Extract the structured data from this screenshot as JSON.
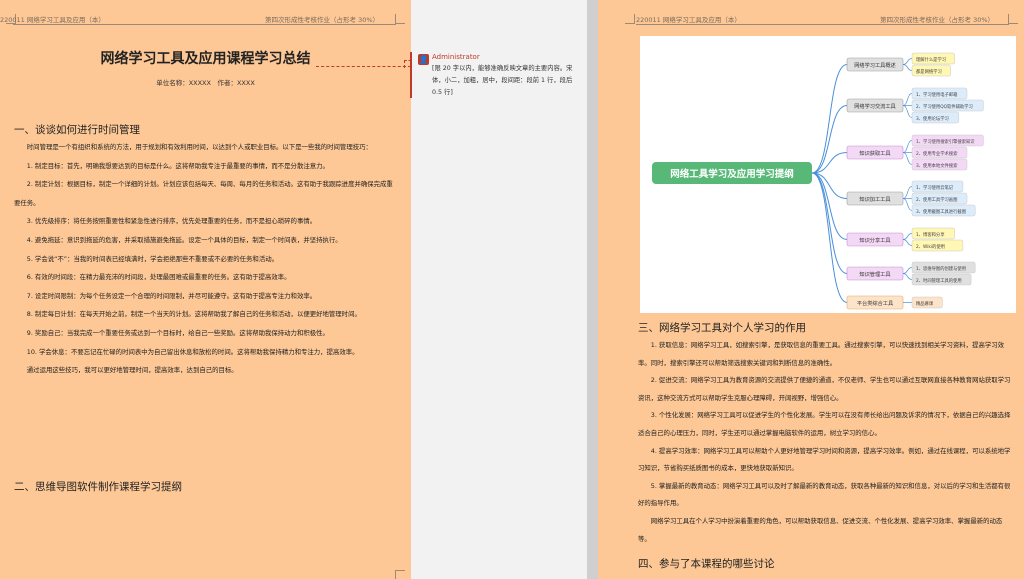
{
  "left_page": {
    "header_left": "220011 网络学习工具及应用（本）",
    "header_right": "第四次形成性考核作业（占形考 30%）",
    "title": "网络学习工具及应用课程学习总结",
    "subtitle": "单位名称：XXXXX　作者：XXXX",
    "section1": "一、谈谈如何进行时间管理",
    "intro": "时间管理是一个有组织和系统的方法，用于规划和有效利用时间，以达到个人或职业目标。以下是一些我的时间管理技巧：",
    "items": [
      "1. 制定目标：首先，明确我想要达到的目标是什么。这将帮助我专注于最重要的事情，而不是分散注意力。",
      "2. 制定计划：根据目标，制定一个详细的计划。计划应该包括每天、每周、每月的任务和活动。这有助于我跟踪进度并确保完成重要任务。",
      "3. 优先级排序：将任务按照重要性和紧急性进行排序，优先处理重要的任务，而不是担心琐碎的事情。",
      "4. 避免拖延：意识到拖延的危害，并采取措施避免拖延。设定一个具体的目标，制定一个时间表，并坚持执行。",
      "5. 学会说“不”：当我的时间表已经填满时，学会拒绝那些不重要或不必要的任务和活动。",
      "6. 有效的时间段：在精力最充沛的时间段，处理最困难或最重要的任务。这有助于提高效率。",
      "7. 设定时间限制：为每个任务设定一个合理的时间限制，并尽可能遵守。这有助于提高专注力和效率。",
      "8. 制定每日计划：在每天开始之前，制定一个当天的计划。这将帮助我了解自己的任务和活动，以便更好地管理时间。",
      "9. 奖励自己：当我完成一个重要任务或达到一个目标时，给自己一些奖励。这将帮助我保持动力和积极性。",
      "10. 学会休息：不要忘记在忙碌的时间表中为自己留出休息和放松的时间。这将帮助我保持精力和专注力，提高效率。"
    ],
    "conclusion": "通过运用这些技巧，我可以更好地管理时间，提高效率，达到自己的目标。",
    "section2": "二、思维导图软件制作课程学习提纲"
  },
  "comment": {
    "author": "Administrator",
    "text": "[限 20 字以内，能够准确反映文章的主要内容。宋体，小二，加粗，居中，段间距：段前 1 行，段后 0.5 行]",
    "avatar": "👤"
  },
  "right_page": {
    "header_left": "220011 网络学习工具及应用（本）",
    "header_right": "第四次形成性考核作业（占形考 30%）",
    "mindmap": {
      "root": "网络工具学习及应用学习提纲",
      "branches": [
        {
          "label": "网络学习工具概述",
          "color": "#e0e0e0",
          "stroke": "#9e9e9e",
          "children": [
            "理解什么是学习",
            "都是网络学习"
          ],
          "child_fill": "#fff7b3"
        },
        {
          "label": "网络学习交流工具",
          "color": "#e0e0e0",
          "stroke": "#9e9e9e",
          "children": [
            "1、学习使用电子邮箱",
            "2、学习使用QQ软件辅助学习",
            "3、使用论坛学习"
          ],
          "child_fill": "#dcecfb"
        },
        {
          "label": "知识获取工具",
          "color": "#f3d9f5",
          "stroke": "#c48fd0",
          "children": [
            "1、学习使用搜索引擎搜索知识",
            "2、使用专业学术搜索",
            "3、使用本地文件搜索"
          ],
          "child_fill": "#f3d9f5"
        },
        {
          "label": "知识加工工具",
          "color": "#e0e0e0",
          "stroke": "#9e9e9e",
          "children": [
            "1、学习使用云笔记",
            "2、使用工具学习画图",
            "3、使用截图工具进行截图"
          ],
          "child_fill": "#dcecfb"
        },
        {
          "label": "知识分享工具",
          "color": "#f3d9f5",
          "stroke": "#c48fd0",
          "children": [
            "1、博客和分享",
            "2、Wiki的使用"
          ],
          "child_fill": "#fff7b3"
        },
        {
          "label": "知识管理工具",
          "color": "#f3d9f5",
          "stroke": "#c48fd0",
          "children": [
            "1、思维导图的创建与使用",
            "2、时间管理工具的使用"
          ],
          "child_fill": "#e0e0e0"
        },
        {
          "label": "平台类综合工具",
          "color": "#fde3c8",
          "stroke": "#e6a970",
          "children": [
            "精品慕课"
          ],
          "child_fill": "#fde3c8"
        }
      ]
    },
    "section3": "三、网络学习工具对个人学习的作用",
    "paragraphs": [
      "1. 获取信息：网络学习工具，如搜索引擎，是获取信息的重要工具。通过搜索引擎，可以快速找到相关学习资料，提高学习效率。同时，搜索引擎还可以帮助筛选搜索关键词和判断信息的准确性。",
      "2. 促进交流：网络学习工具为教育资源的交流提供了便捷的通道，不仅老师、学生也可以通过互联网直接各种教育网站获取学习资讯，这种交流方式可以帮助学生克服心理障碍，开阔视野，增强信心。",
      "3. 个性化发展：网络学习工具可以促进学生的个性化发展。学生可以在没有师长给出问题及诉求的情况下，依据自己的兴趣选择适合自己的心理压力，同时，学生还可以通过掌握电脑软件的运用，树立学习的信心。",
      "4. 提高学习效率：网络学习工具可以帮助个人更好地管理学习时间和资源，提高学习效率。例如，通过在线课程，可以系统地学习知识，节省购买纸质图书的成本，更快地获取新知识。",
      "5. 掌握最新的教育动态：网络学习工具可以及时了解最新的教育动态，获取各种最新的知识和信息，对以后的学习和生活都有很好的指导作用。"
    ],
    "summary": "网络学习工具在个人学习中扮演着重要的角色，可以帮助获取信息、促进交流、个性化发展、提高学习效率、掌握最新的动态等。",
    "section4": "四、参与了本课程的哪些讨论"
  }
}
